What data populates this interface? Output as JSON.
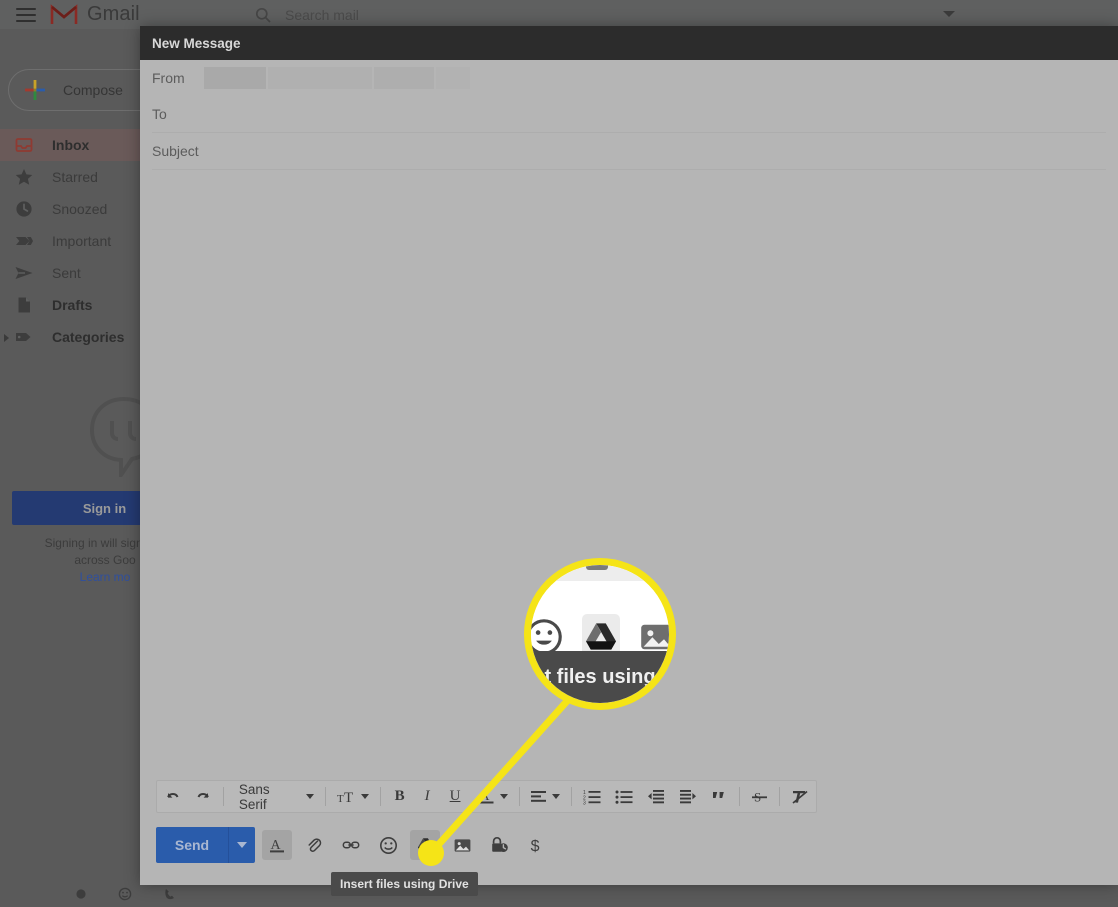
{
  "app": {
    "name": "Gmail",
    "menu_icon": "hamburger-icon",
    "logo_icon": "gmail-m-icon"
  },
  "search": {
    "icon": "search-icon",
    "placeholder": "Search mail",
    "options_icon": "chevron-down-icon"
  },
  "sidebar": {
    "compose": {
      "label": "Compose",
      "icon": "plus-icon"
    },
    "items": [
      {
        "label": "Inbox",
        "icon": "inbox-icon",
        "active": true,
        "bold": true,
        "expandable": false
      },
      {
        "label": "Starred",
        "icon": "star-icon",
        "active": false,
        "bold": false,
        "expandable": false
      },
      {
        "label": "Snoozed",
        "icon": "clock-icon",
        "active": false,
        "bold": false,
        "expandable": false
      },
      {
        "label": "Important",
        "icon": "label-icon",
        "active": false,
        "bold": false,
        "expandable": false
      },
      {
        "label": "Sent",
        "icon": "send-icon",
        "active": false,
        "bold": false,
        "expandable": false
      },
      {
        "label": "Drafts",
        "icon": "draft-icon",
        "active": false,
        "bold": true,
        "expandable": false
      },
      {
        "label": "Categories",
        "icon": "tag-icon",
        "active": false,
        "bold": true,
        "expandable": true
      }
    ],
    "hangouts": {
      "logo_icon": "hangouts-icon",
      "signin_label": "Sign in",
      "note_line1": "Signing in will sign you",
      "note_line2": "across Goo",
      "note_link": "Learn mo"
    },
    "status_icons": [
      "status-dot-icon",
      "emoji-icon",
      "phone-icon"
    ]
  },
  "compose": {
    "title": "New Message",
    "fields": [
      {
        "label": "From",
        "value": "",
        "redacted": true
      },
      {
        "label": "To",
        "value": "",
        "redacted": false
      },
      {
        "label": "Subject",
        "value": "",
        "redacted": false
      }
    ],
    "format_toolbar": {
      "undo_icon": "undo-icon",
      "redo_icon": "redo-icon",
      "font_name": "Sans Serif",
      "font_caret_icon": "chevron-down-icon",
      "size_icon": "font-size-icon",
      "size_caret_icon": "chevron-down-icon",
      "bold_label": "B",
      "italic_label": "I",
      "underline_label": "U",
      "text_color_icon": "text-color-icon",
      "text_color_caret_icon": "chevron-down-icon",
      "align_icon": "align-left-icon",
      "align_caret_icon": "chevron-down-icon",
      "numbered_list_icon": "numbered-list-icon",
      "bulleted_list_icon": "bulleted-list-icon",
      "outdent_icon": "outdent-icon",
      "indent_icon": "indent-icon",
      "quote_icon": "block-quote-icon",
      "strikethrough_icon": "strikethrough-icon",
      "remove_format_icon": "remove-formatting-icon"
    },
    "actions": {
      "send_label": "Send",
      "send_caret_icon": "chevron-down-icon",
      "buttons": [
        {
          "name": "formatting-options",
          "icon": "text-format-icon",
          "selected": true
        },
        {
          "name": "attach-files",
          "icon": "paperclip-icon",
          "selected": false
        },
        {
          "name": "insert-link",
          "icon": "link-icon",
          "selected": false
        },
        {
          "name": "insert-emoji",
          "icon": "emoji-icon",
          "selected": false
        },
        {
          "name": "insert-drive-files",
          "icon": "google-drive-icon",
          "selected": true
        },
        {
          "name": "insert-photo",
          "icon": "image-icon",
          "selected": false
        },
        {
          "name": "confidential-mode",
          "icon": "lock-clock-icon",
          "selected": false
        },
        {
          "name": "insert-signature",
          "icon": "dollar-icon",
          "selected": false
        }
      ]
    },
    "tooltip": "Insert files using Drive"
  },
  "callout": {
    "accent_color": "#f5e417",
    "magnified_tooltip_text": "t files using",
    "magnified_icons": [
      "emoji-icon",
      "google-drive-icon",
      "image-icon"
    ]
  },
  "colors": {
    "scrim": "#5a5a5a",
    "modal_bg": "#b5b5b5",
    "modal_header": "#2c2c2c",
    "send_blue": "#2a5cab",
    "inbox_red": "#8f3a32",
    "callout_yellow": "#f5e417",
    "tooltip_bg": "#4a4a4a"
  }
}
